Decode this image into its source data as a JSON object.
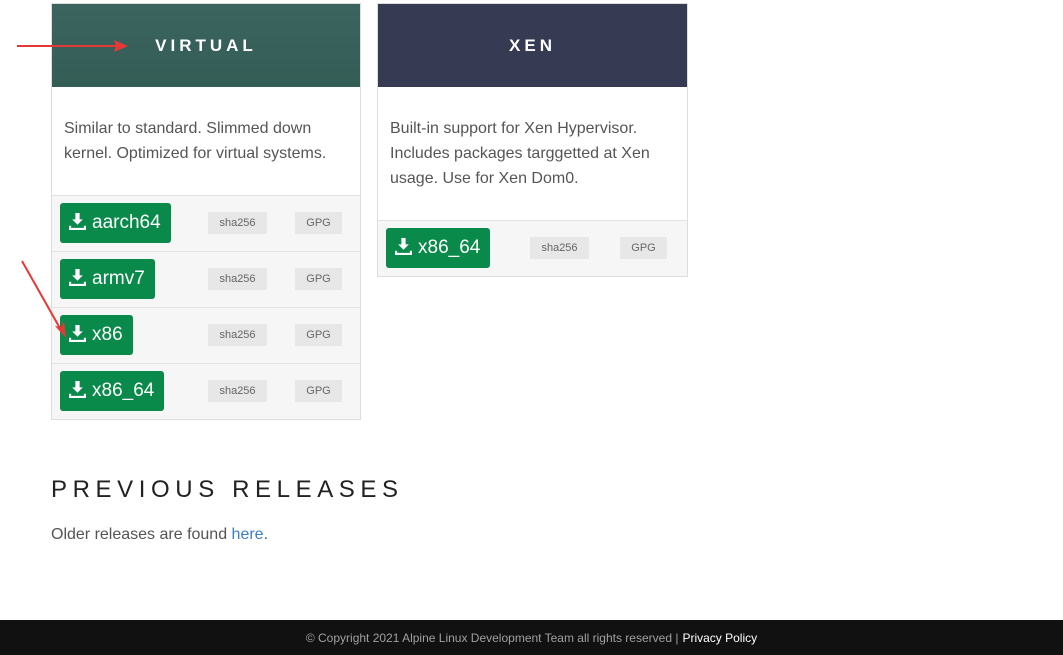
{
  "colors": {
    "virtual_header": "#3b645f",
    "xen_header": "#363a52",
    "download_button": "#09894a",
    "link": "#3d7ec4",
    "footer_bg": "#111111",
    "annotation_arrow": "#e53935"
  },
  "virtual": {
    "title": "VIRTUAL",
    "description": "Similar to standard. Slimmed down kernel. Optimized for virtual systems.",
    "downloads": [
      {
        "arch": "aarch64",
        "sha": "sha256",
        "gpg": "GPG"
      },
      {
        "arch": "armv7",
        "sha": "sha256",
        "gpg": "GPG"
      },
      {
        "arch": "x86",
        "sha": "sha256",
        "gpg": "GPG"
      },
      {
        "arch": "x86_64",
        "sha": "sha256",
        "gpg": "GPG"
      }
    ]
  },
  "xen": {
    "title": "XEN",
    "description": "Built-in support for Xen Hypervisor. Includes packages targgetted at Xen usage. Use for Xen Dom0.",
    "downloads": [
      {
        "arch": "x86_64",
        "sha": "sha256",
        "gpg": "GPG"
      }
    ]
  },
  "previous_releases": {
    "title": "PREVIOUS RELEASES",
    "text": "Older releases are found ",
    "link_text": "here",
    "suffix": "."
  },
  "footer": {
    "copyright": "© Copyright 2021 Alpine Linux Development Team all rights reserved |",
    "privacy_link": "Privacy Policy"
  },
  "icons": {
    "download": "download-icon"
  }
}
